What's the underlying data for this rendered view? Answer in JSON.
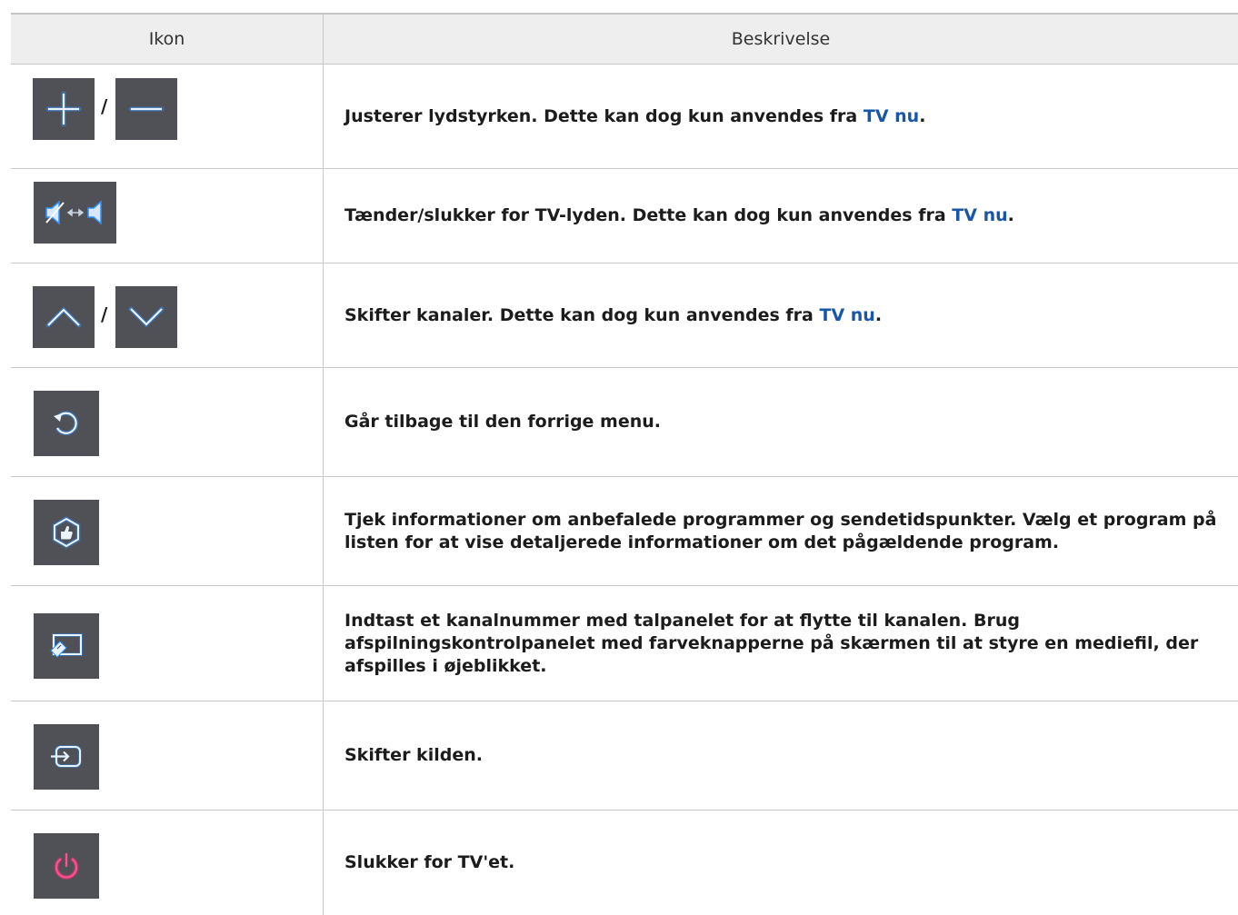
{
  "table": {
    "headers": {
      "icon": "Ikon",
      "description": "Beskrivelse"
    },
    "rows": [
      {
        "icons": [
          "plus-icon",
          "minus-icon"
        ],
        "separator": "/",
        "text": "Justerer lydstyrken. Dette kan dog kun anvendes fra ",
        "link": "TV nu",
        "suffix": "."
      },
      {
        "icons": [
          "mute-toggle-icon"
        ],
        "text": "Tænder/slukker for TV-lyden. Dette kan dog kun anvendes fra ",
        "link": "TV nu",
        "suffix": "."
      },
      {
        "icons": [
          "chevron-up-icon",
          "chevron-down-icon"
        ],
        "separator": "/",
        "text": "Skifter kanaler. Dette kan dog kun anvendes fra ",
        "link": "TV nu",
        "suffix": "."
      },
      {
        "icons": [
          "return-icon"
        ],
        "text": "Går tilbage til den forrige menu."
      },
      {
        "icons": [
          "recommended-icon"
        ],
        "text": "Tjek informationer om anbefalede programmer og sendetidspunkter. Vælg et program på listen for at vise detaljerede informationer om det pågældende program."
      },
      {
        "icons": [
          "keypad-icon"
        ],
        "text": "Indtast et kanalnummer med talpanelet for at flytte til kanalen. Brug afspilningskontrolpanelet med farveknapperne på skærmen til at styre en mediefil, der afspilles i øjeblikket."
      },
      {
        "icons": [
          "source-icon"
        ],
        "text": "Skifter kilden."
      },
      {
        "icons": [
          "power-icon"
        ],
        "text": "Slukker for TV'et."
      }
    ]
  },
  "colors": {
    "button_bg": "#4f5156",
    "glow": "#2f8fff",
    "power": "#ff2a7a",
    "link": "#1a56a8",
    "header_bg": "#eeeeee"
  }
}
